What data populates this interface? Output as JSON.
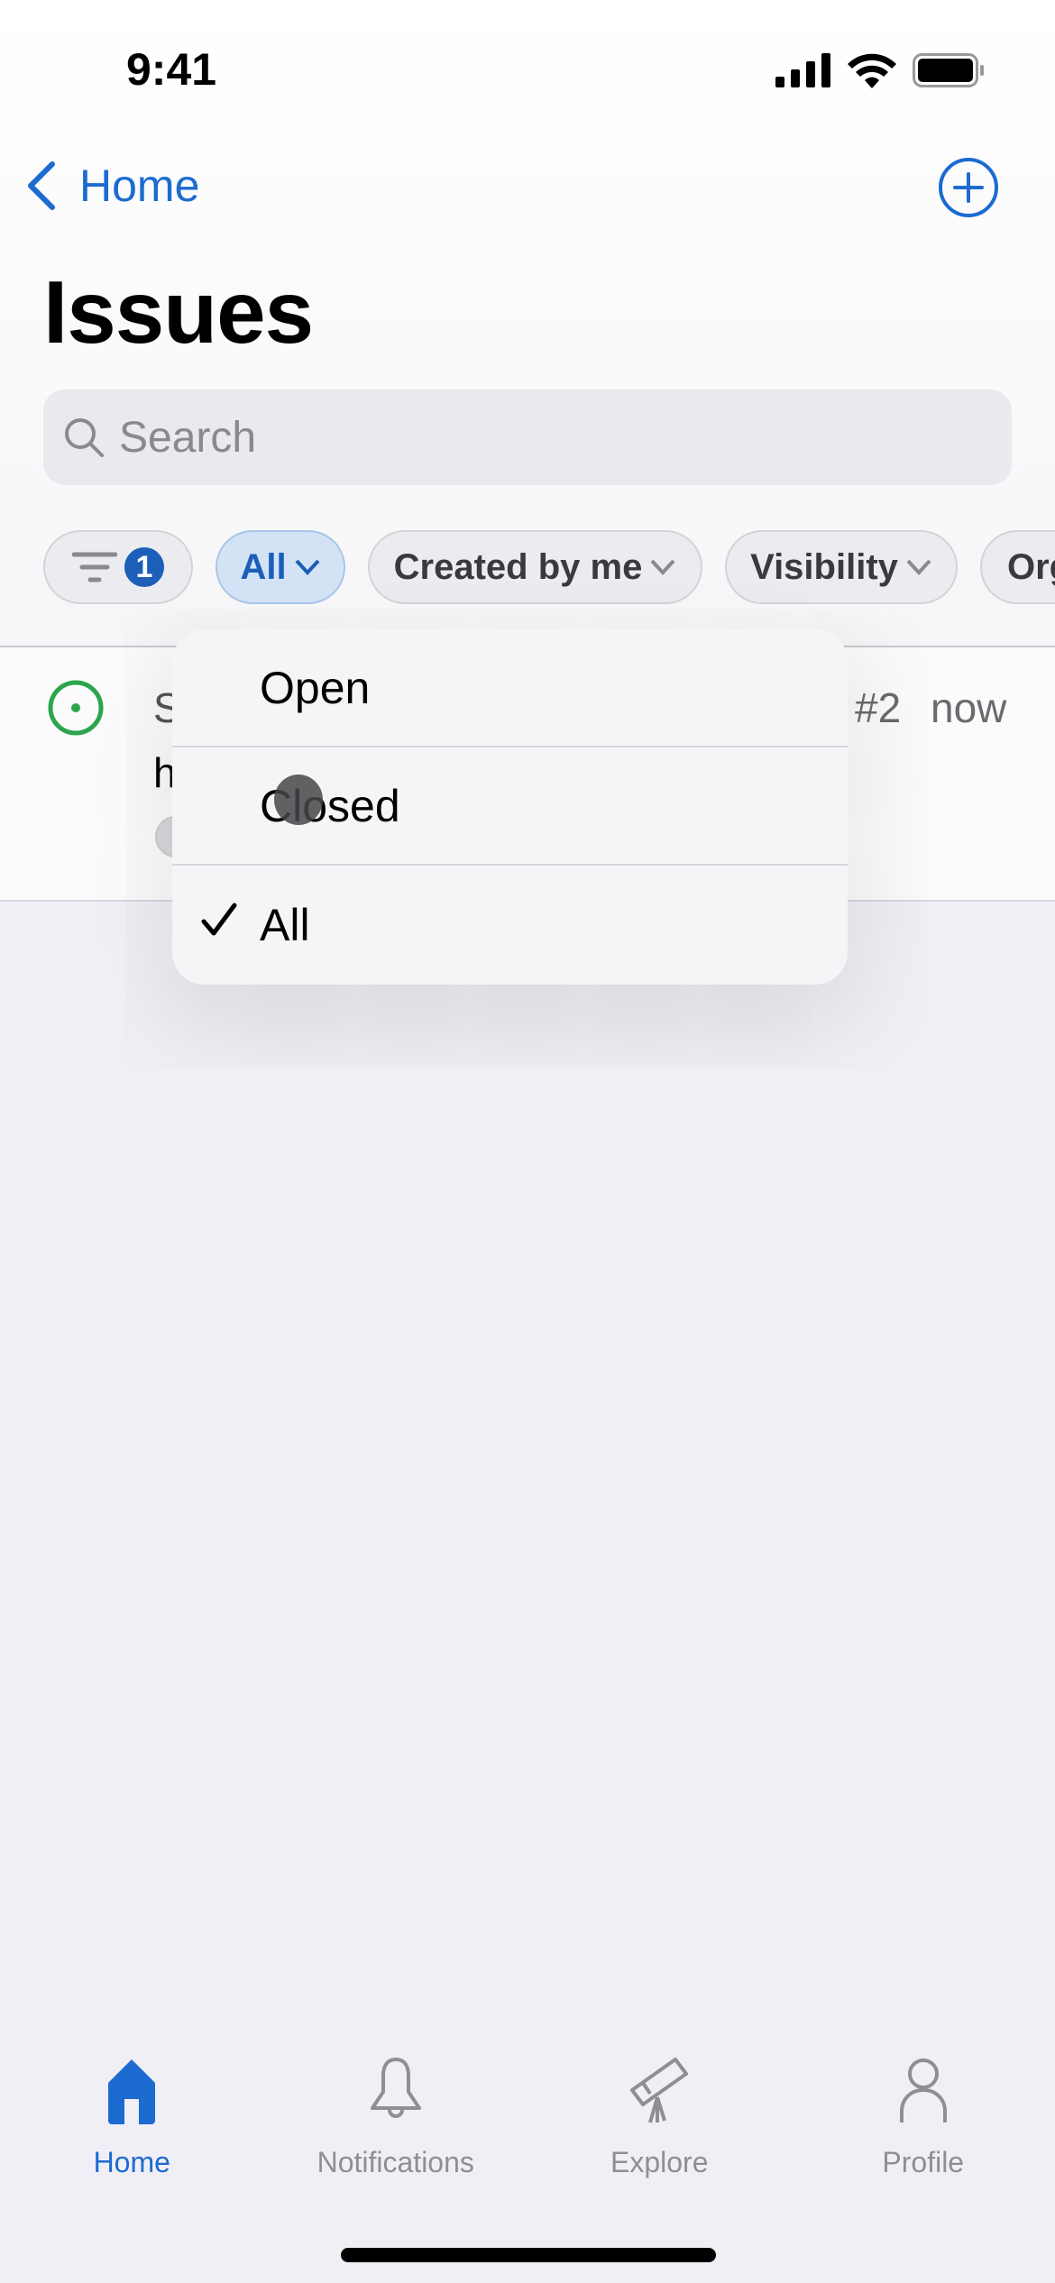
{
  "status_bar": {
    "time": "9:41"
  },
  "nav": {
    "back_label": "Home",
    "title": "Issues"
  },
  "search": {
    "placeholder": "Search"
  },
  "filters": {
    "count_badge": "1",
    "chips": [
      {
        "label": "All",
        "active": true
      },
      {
        "label": "Created by me"
      },
      {
        "label": "Visibility"
      },
      {
        "label": "Org"
      }
    ]
  },
  "issue": {
    "title_partial": "S",
    "body_partial": "h",
    "number": "#2",
    "time": "now",
    "state_color": "#2da44e"
  },
  "menu": {
    "items": [
      {
        "label": "Open",
        "checked": false
      },
      {
        "label": "Closed",
        "checked": false
      },
      {
        "label": "All",
        "checked": true
      }
    ]
  },
  "tabs": [
    {
      "label": "Home",
      "icon": "house-fill-icon",
      "active": true
    },
    {
      "label": "Notifications",
      "icon": "bell-icon"
    },
    {
      "label": "Explore",
      "icon": "telescope-icon"
    },
    {
      "label": "Profile",
      "icon": "person-icon"
    }
  ],
  "colors": {
    "accent": "#1c6bd0",
    "open": "#2da44e"
  }
}
